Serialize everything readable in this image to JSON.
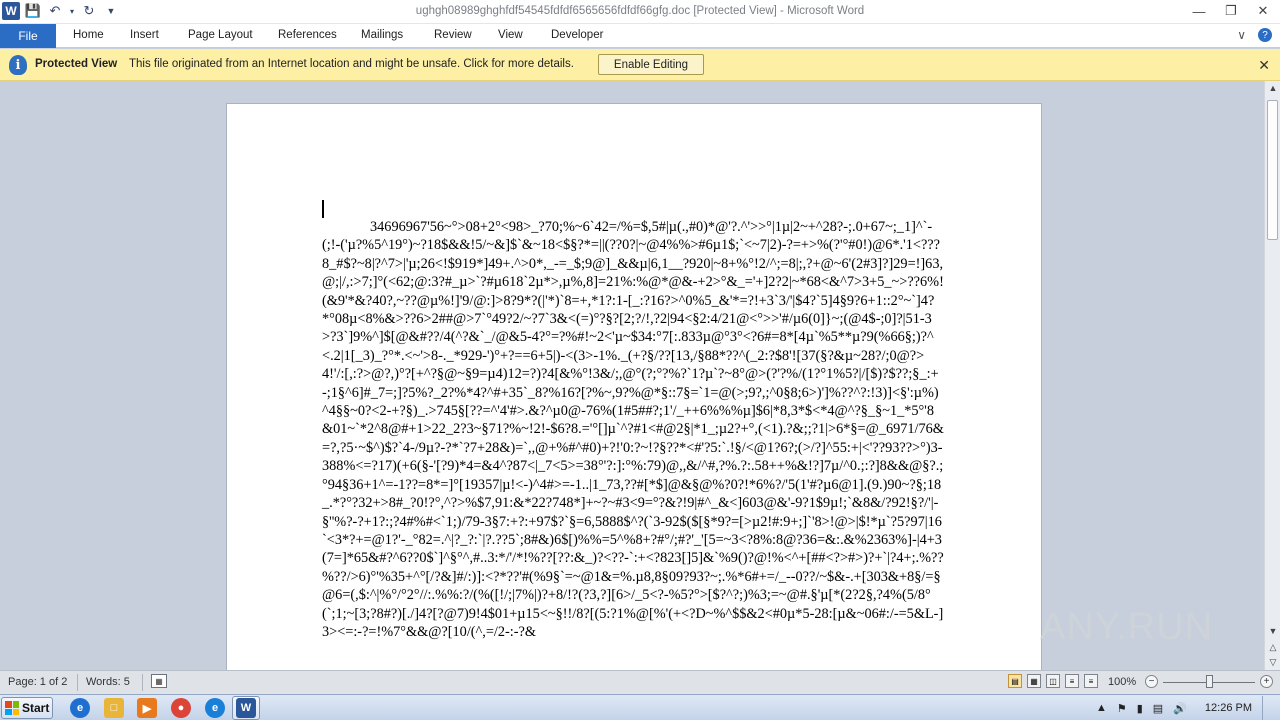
{
  "titlebar": {
    "title": "ughgh08989ghghfdf54545fdfdf6565656fdfdf66gfg.doc [Protected View] - Microsoft Word",
    "app_icon": "W"
  },
  "ribbon": {
    "file_tab": "File",
    "tabs": [
      "Home",
      "Insert",
      "Page Layout",
      "References",
      "Mailings",
      "Review",
      "View",
      "Developer"
    ]
  },
  "protected_view": {
    "title": "Protected View",
    "message": "This file originated from an Internet location and might be unsafe. Click for more details.",
    "enable_button": "Enable Editing"
  },
  "document": {
    "body": "34696967'56~°>08+2°<98>_?70;%~6`42=/%=$,5#|µ(.,#0)*@'?.^'>>°|1µ|2~+^28?-;.0+67~;_1]^`-(;!-('µ?%5^19°)~?18$&&!5/~&]$`&~18<$§?*=||(??0?|~@4%%>#6µ1$;`<~7|2)-?=+>%(?'°#0!)@6*.'1<???8_#$?~8|?^7>|'µ;26<!$919*]49+.^>0*,_-=_$;9@]_&&µ|6,1__?920|~8+%°!2/^;=8|;,?+@~6'(2#3]?]29=!]63,@;|/,:>7;]°(<62;@:3?#_µ>`?#µ618`2µ*>,µ%,8]=21%:%@*@&-+2>°&_='+]2?2|~*68<&^7>3+5_~>??6%!(&9'*&?40?,~??@µ%!]'9/@:]>8?9*?(|'*)`8=+,*1?:1-[_:?16?>^0%5_&'*=?!+3`3/'|$4?`5]4§9?6+1::2°~`]4?*°08µ<8%&>??6>2##@>7`°49?2/~?7`3&<(=)°?§?[2;?/!,?2|94<§2:4/21@<°>>'#/µ6(0]}~;(@4$-;0]?|51-3>?3`]9%^]$[@&#??/4(^?&`_/@&5-4?°=?%#!~2<'µ~$34:°7[:.833µ@°3°<?6#=8*[4µ`%5**µ?9(%66§;)?^<.2|1[_3)_?°*.<~'>8-._*929-')°+?==6+5|)-<(3>-1%._(+?§/??[13,/§88*??^(_2:?$8'![37(§?&µ~28?/;0@?>4!'/:[,:?>@?,)°?[+^?§@~§9=µ4)12=?)?4[&%°!3&/;,@°(?;°?%?`1?µ`?~8°@>(?'?%/(1?°1%5?|/[$)?$??;§_:+-;1§^6]#_7=;]?5%?_2?%*4?^#+35`_8?%16?[?%~,9?%@*§::7§=`1=@(>;9?,;^0§8;6>)']%??^?:!3)]<§':µ%)^4§§~0?<2-+?§)_.>745§[??=^'4'#>.&?^µ0@-76%(1#5##?;1'/_++6%%%µ]$6|*8,3*$<*4@^?§_§~1_*5°'8&01~`*2^8@#+1>22_2?3~§71?%~!2!-$6?8.='°[]µ`^?#1<#@2§|*1_;µ2?+°,(<1).?&;;?1|>6*§=@_6971/76&=?,?5·~$^)$?`4-/9µ?-?*`?7+28&)=`,,@+%#^#0)+?!'0:?~!?§??*<#'?5:`.!§/<@1?6?;(>/?]^55:+|<'??93??>°)3-388%<=?17)(+6(§-'[?9)*4=&4^?87<|_7<5>=38°'?:]:°%:79)@,,&/^#,?%.?:.58++%&!?]7µ/^0.;:?]8&&@§?.;°94§36+1^=-1??=8*=]°[19357|µ!<-)^4#>=-1..|1_73,??#[*$]@&§@%?0?!*6%?/'5(1'#?µ6@1].(9.)90~?§;18_.*?°?32+>8#_?0!?°,^?>%$7,91:&*22?748*]+~?~#3<9=°?&?!9|#^_&<]603@&'-9?1$9µ!;`&8&/?92!§?/'|-§''%?-?+1?:;?4#%#<`1;)/79-3§7:+?:+97$?`§=6,5888$^?(`3-92$($[§*9?=[>µ2!#:9+;]`'8>!@>|$!*µ`?5?97|16`<3*?+=@1?'-_°82=.^|?_?:`|?.??5`;8#&)6$[)%%=5^%8+?#°/;#?'_'[5=~3<?8%:8@?36=&:.&%2363%]-|4+3(7=]*65&#?^6??0$`]^§°^,#..3:*/'/*!%??[??:&_)?<??-`:+<?823[]5]&`%9()?@!%<^+[##<?>#>)?+`|?4+;.%??%??/>6)°'%35+^°[/?&]#/:)]:<?*??'#(%9§`=~@1&=%.µ8,8§09?93?~;.%*6#+=/_--0??/~$&-.+[303&+8§/=§@6=(,$:^|%°/°2°//:.%%:?/(%([!/;|7%|)?+8/!?(?3,?][6>/_5<?-%5?°>[$?^?;)%3;=~@#.§'µ[*(2?2§,?4%(5/8°(`;1;~[3;?8#?)[./]4?[?@7)9!4$01+µ15<~§!!/8?[(5:?1%@[%'(+<?D~%^$$&2<#0µ*5-28:[µ&~06#:/-=5&L-]3><=:-?=!%7°&&@?[10/(^,=/2-:-?&"
  },
  "watermark": "ANY.RUN",
  "statusbar": {
    "page": "Page: 1 of 2",
    "words": "Words: 5",
    "zoom": "100%"
  },
  "taskbar": {
    "start_label": "Start",
    "clock": "12:26 PM"
  },
  "colors": {
    "file_tab": "#2b6cc4",
    "protected_bar": "#fdf0a5",
    "doc_background": "#c6cfdb"
  }
}
